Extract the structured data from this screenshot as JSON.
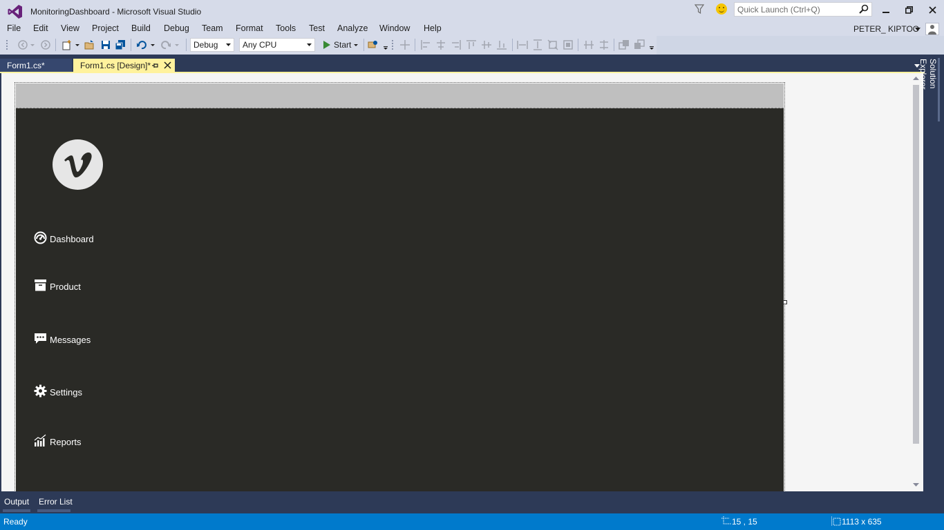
{
  "window": {
    "title": "MonitoringDashboard - Microsoft Visual Studio",
    "quick_launch_placeholder": "Quick Launch (Ctrl+Q)",
    "user_name": "PETER_ KIPTOO"
  },
  "menu": {
    "items": [
      "File",
      "Edit",
      "View",
      "Project",
      "Build",
      "Debug",
      "Team",
      "Format",
      "Tools",
      "Test",
      "Analyze",
      "Window",
      "Help"
    ]
  },
  "toolbar": {
    "configuration": "Debug",
    "platform": "Any CPU",
    "start_label": "Start"
  },
  "tabs": {
    "code_tab": "Form1.cs*",
    "design_tab": "Form1.cs [Design]*"
  },
  "form": {
    "nav": [
      {
        "label": "Dashboard",
        "icon": "speedometer-icon"
      },
      {
        "label": "Product",
        "icon": "archive-box-icon"
      },
      {
        "label": "Messages",
        "icon": "chat-bubble-icon"
      },
      {
        "label": "Settings",
        "icon": "gear-icon"
      },
      {
        "label": "Reports",
        "icon": "bar-chart-icon"
      }
    ],
    "logo_letter": "v",
    "colors": {
      "body": "#2a2a26",
      "titlebar": "#bfbfbf"
    }
  },
  "side_panel": {
    "solution_explorer": "Solution Explorer"
  },
  "bottom": {
    "output": "Output",
    "error_list": "Error List"
  },
  "status": {
    "text": "Ready",
    "position": "15 , 15",
    "size": "1113 x 635"
  },
  "colors": {
    "status_bar": "#007acc",
    "active_tab": "#fff29d",
    "chrome": "#d6dbe9",
    "doc_well": "#2d3a57"
  }
}
